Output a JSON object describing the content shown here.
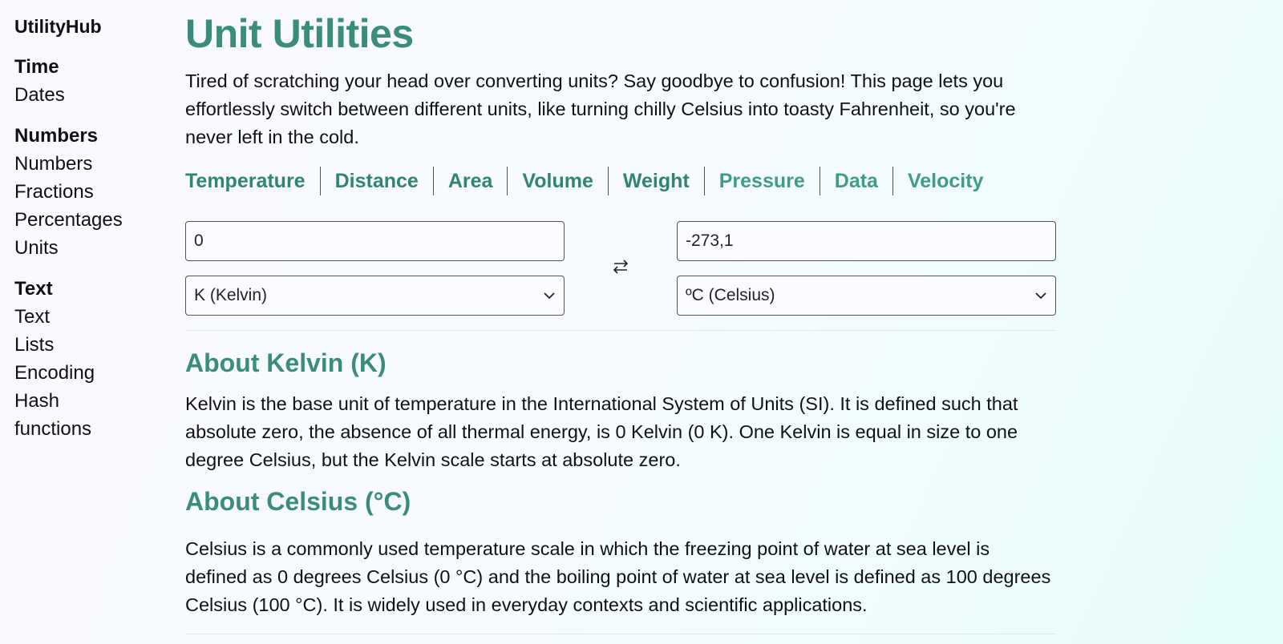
{
  "sidebar": {
    "brand": "UtilityHub",
    "groups": [
      {
        "title": "Time",
        "items": [
          "Dates"
        ]
      },
      {
        "title": "Numbers",
        "items": [
          "Numbers",
          "Fractions",
          "Percentages",
          "Units"
        ]
      },
      {
        "title": "Text",
        "items": [
          "Text",
          "Lists",
          "Encoding",
          "Hash functions"
        ]
      }
    ]
  },
  "main": {
    "title": "Unit Utilities",
    "intro": "Tired of scratching your head over converting units? Say goodbye to confusion! This page lets you effortlessly switch between different units, like turning chilly Celsius into toasty Fahrenheit, so you're never left in the cold.",
    "tabs": [
      "Temperature",
      "Distance",
      "Area",
      "Volume",
      "Weight",
      "Pressure",
      "Data",
      "Velocity"
    ],
    "converter": {
      "input_value": "0",
      "from_unit": "K (Kelvin)",
      "output_value": "-273,1",
      "to_unit": "ºC (Celsius)",
      "swap_icon": "swap-arrows-icon"
    },
    "sections": [
      {
        "title": "About Kelvin (K)",
        "text": "Kelvin is the base unit of temperature in the International System of Units (SI). It is defined such that absolute zero, the absence of all thermal energy, is 0 Kelvin (0 K). One Kelvin is equal in size to one degree Celsius, but the Kelvin scale starts at absolute zero."
      },
      {
        "title": "About Celsius (°C)",
        "text": "Celsius is a commonly used temperature scale in which the freezing point of water at sea level is defined as 0 degrees Celsius (0 °C) and the boiling point of water at sea level is defined as 100 degrees Celsius (100 °C). It is widely used in everyday contexts and scientific applications."
      }
    ]
  },
  "colors": {
    "accent": "#3a8c7c",
    "tab_text": "#2e8570",
    "border": "#5a5352"
  }
}
